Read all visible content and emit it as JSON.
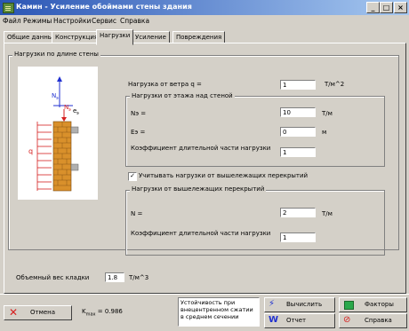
{
  "window": {
    "title": "Камин - Усиление обоймами стены здания",
    "minimize": "_",
    "maximize": "□",
    "close": "×"
  },
  "menu": [
    "Файл",
    "Режимы",
    "Настройки",
    "Сервис",
    "Справка"
  ],
  "tabs": [
    "Общие данные",
    "Конструкция",
    "Нагрузки",
    "Усиление",
    "Повреждения"
  ],
  "active_tab": 2,
  "main": {
    "group_title": "Нагрузки по длине стены",
    "wind": {
      "label": "Нагрузка от ветра q =",
      "value": "1",
      "unit": "Т/м^2"
    },
    "floor_group": {
      "title": "Нагрузки от этажа над стеной",
      "n_label": "Nэ =",
      "n_value": "10",
      "n_unit": "Т/м",
      "e_label": "Eэ =",
      "e_value": "0",
      "e_unit": "м",
      "k_label": "Коэффициент длительной части нагрузки",
      "k_value": "1"
    },
    "checkbox": {
      "label": "Учитывать нагрузки от вышележащих перекрытий",
      "checked": true
    },
    "upper_group": {
      "title": "Нагрузки от вышележащих перекрытий",
      "n_label": "N =",
      "n_value": "2",
      "n_unit": "Т/м",
      "k_label": "Коэффициент длительной части нагрузки",
      "k_value": "1"
    },
    "density": {
      "label": "Объемный вес кладки",
      "value": "1.8",
      "unit": "Т/м^3"
    },
    "diagram": {
      "labels": [
        "N",
        "N",
        "e",
        "q"
      ],
      "subscripts": [
        "э",
        "э",
        "э"
      ]
    }
  },
  "bottom": {
    "cancel_label": "Отмена",
    "k_label": "K",
    "k_sub": "max",
    "k_sep": " = ",
    "k_value": "0.986",
    "status": "Устойчивость при внецентренном сжатии в среднем сечении",
    "calc_label": "Вычислить",
    "factors_label": "Факторы",
    "report_label": "Отчет",
    "help_label": "Справка"
  },
  "colors": {
    "title_gradient_start": "#2a55b5",
    "title_gradient_end": "#a6c8f0",
    "brick": "#d9902b",
    "red": "#d62020",
    "blue": "#2030d0",
    "panel": "#d4d0c8"
  }
}
